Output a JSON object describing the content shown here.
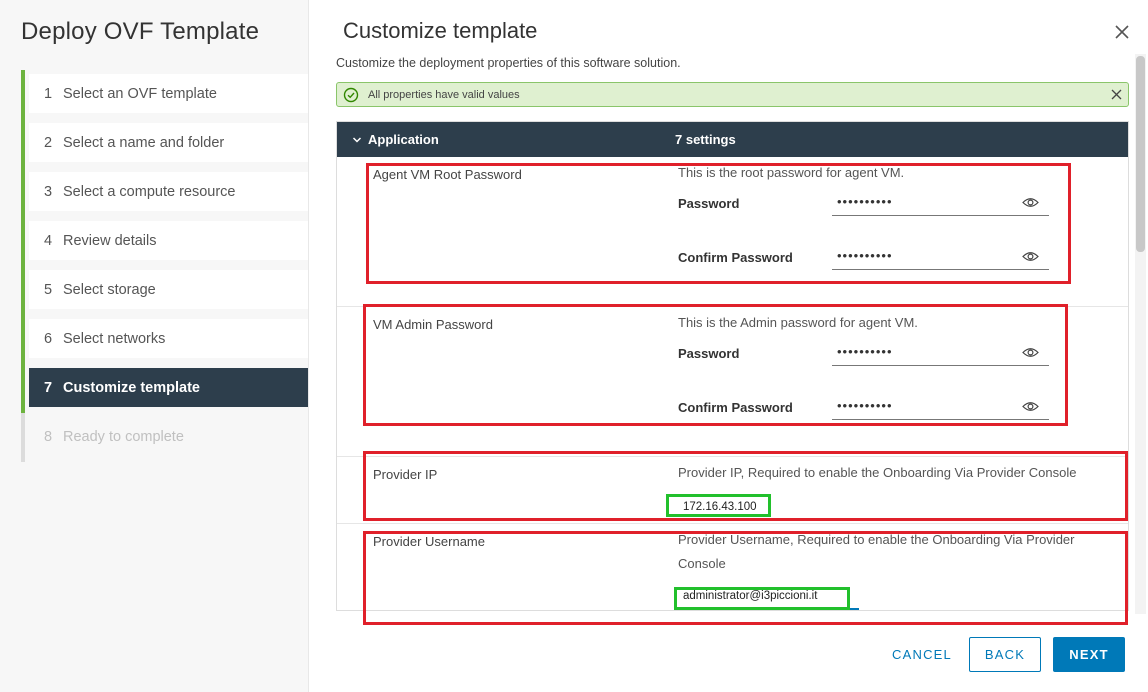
{
  "wizard": {
    "title": "Deploy OVF Template",
    "steps": [
      {
        "num": "1",
        "label": "Select an OVF template"
      },
      {
        "num": "2",
        "label": "Select a name and folder"
      },
      {
        "num": "3",
        "label": "Select a compute resource"
      },
      {
        "num": "4",
        "label": "Review details"
      },
      {
        "num": "5",
        "label": "Select storage"
      },
      {
        "num": "6",
        "label": "Select networks"
      },
      {
        "num": "7",
        "label": "Customize template"
      },
      {
        "num": "8",
        "label": "Ready to complete"
      }
    ]
  },
  "page": {
    "title": "Customize template",
    "subtitle": "Customize the deployment properties of this software solution.",
    "alert": "All properties have valid values"
  },
  "group": {
    "name": "Application",
    "count": "7 settings"
  },
  "properties": {
    "agent_root": {
      "name": "Agent VM Root Password",
      "desc": "This is the root password for agent VM.",
      "password_label": "Password",
      "password_value": "••••••••••",
      "confirm_label": "Confirm Password",
      "confirm_value": "••••••••••"
    },
    "vm_admin": {
      "name": "VM Admin Password",
      "desc": "This is the Admin password for agent VM.",
      "password_label": "Password",
      "password_value": "••••••••••",
      "confirm_label": "Confirm Password",
      "confirm_value": "••••••••••"
    },
    "provider_ip": {
      "name": "Provider IP",
      "desc": "Provider IP, Required to enable the Onboarding Via Provider Console",
      "value": "172.16.43.100"
    },
    "provider_username": {
      "name": "Provider Username",
      "desc": "Provider Username, Required to enable the Onboarding Via Provider Console",
      "value": "administrator@i3piccioni.it"
    }
  },
  "buttons": {
    "cancel": "CANCEL",
    "back": "BACK",
    "next": "NEXT"
  },
  "colors": {
    "accent": "#0079b8",
    "active_step": "#2d3e4c",
    "step_bar": "#6db33f",
    "annotation_red": "#e0202a",
    "annotation_green": "#22c02c"
  }
}
